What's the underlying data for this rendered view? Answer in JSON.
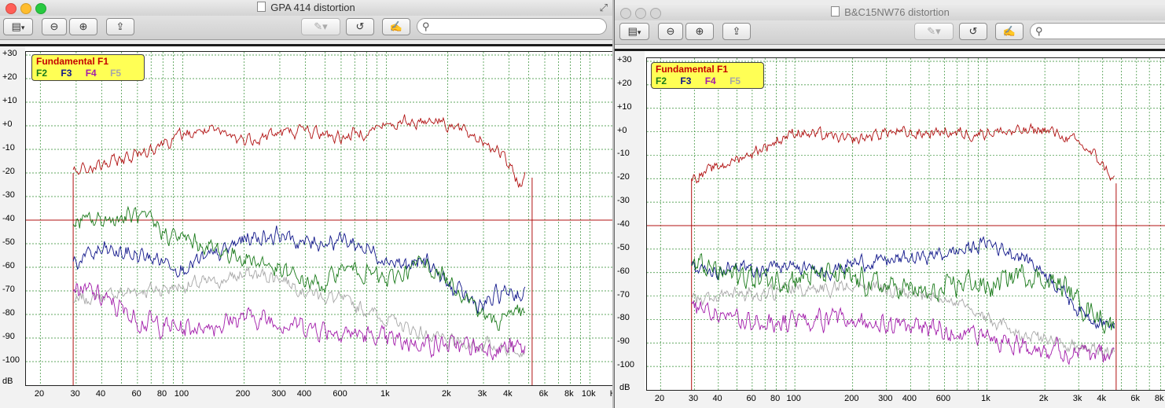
{
  "windows": [
    {
      "title": "GPA 414 distortion",
      "chart_data": {
        "type": "line",
        "xscale": "log",
        "xlim": [
          17,
          13000
        ],
        "ylim": [
          -110,
          30
        ],
        "yunit": "dB",
        "yticks": [
          "+30",
          "+20",
          "+10",
          "+0",
          "-10",
          "-20",
          "-30",
          "-40",
          "-50",
          "-60",
          "-70",
          "-80",
          "-90",
          "-100"
        ],
        "xticks": [
          {
            "v": 20,
            "t": "20"
          },
          {
            "v": 30,
            "t": "30"
          },
          {
            "v": 40,
            "t": "40"
          },
          {
            "v": 60,
            "t": "60"
          },
          {
            "v": 80,
            "t": "80"
          },
          {
            "v": 100,
            "t": "100"
          },
          {
            "v": 200,
            "t": "200"
          },
          {
            "v": 300,
            "t": "300"
          },
          {
            "v": 400,
            "t": "400"
          },
          {
            "v": 600,
            "t": "600"
          },
          {
            "v": 1000,
            "t": "1k"
          },
          {
            "v": 2000,
            "t": "2k"
          },
          {
            "v": 3000,
            "t": "3k"
          },
          {
            "v": 4000,
            "t": "4k"
          },
          {
            "v": 6000,
            "t": "6k"
          },
          {
            "v": 8000,
            "t": "8k"
          },
          {
            "v": 10000,
            "t": "10k"
          },
          {
            "v": 13000,
            "t": "H"
          }
        ],
        "range_start_hz": 29,
        "range_end_hz": 5200,
        "reference_level": -40,
        "legend_title": "Fundamental F1",
        "legend_items": [
          "F2",
          "F3",
          "F4",
          "F5"
        ],
        "series": [
          {
            "name": "Fundamental F1",
            "color": "#b01010",
            "noise": 2.2,
            "points": [
              [
                29,
                -20
              ],
              [
                40,
                -17
              ],
              [
                60,
                -12
              ],
              [
                80,
                -7
              ],
              [
                100,
                -4
              ],
              [
                130,
                -2
              ],
              [
                200,
                -6
              ],
              [
                300,
                -3
              ],
              [
                400,
                -2
              ],
              [
                600,
                -5
              ],
              [
                800,
                -2
              ],
              [
                1000,
                0
              ],
              [
                1400,
                2
              ],
              [
                1800,
                3
              ],
              [
                2200,
                -1
              ],
              [
                3000,
                -6
              ],
              [
                3600,
                -11
              ],
              [
                4000,
                -17
              ],
              [
                4500,
                -25
              ],
              [
                4800,
                -22
              ]
            ]
          },
          {
            "name": "F2",
            "color": "#1a7a1a",
            "noise": 3,
            "points": [
              [
                29,
                -41
              ],
              [
                40,
                -40
              ],
              [
                60,
                -38
              ],
              [
                80,
                -45
              ],
              [
                100,
                -48
              ],
              [
                150,
                -53
              ],
              [
                200,
                -56
              ],
              [
                250,
                -58
              ],
              [
                300,
                -62
              ],
              [
                400,
                -66
              ],
              [
                500,
                -68
              ],
              [
                600,
                -60
              ],
              [
                800,
                -62
              ],
              [
                1000,
                -66
              ],
              [
                1500,
                -58
              ],
              [
                2000,
                -65
              ],
              [
                2500,
                -72
              ],
              [
                3000,
                -80
              ],
              [
                3500,
                -84
              ],
              [
                4000,
                -78
              ],
              [
                4800,
                -80
              ]
            ]
          },
          {
            "name": "F3",
            "color": "#10168a",
            "noise": 3,
            "points": [
              [
                29,
                -58
              ],
              [
                40,
                -53
              ],
              [
                60,
                -55
              ],
              [
                80,
                -57
              ],
              [
                100,
                -60
              ],
              [
                150,
                -55
              ],
              [
                200,
                -48
              ],
              [
                300,
                -46
              ],
              [
                400,
                -50
              ],
              [
                600,
                -48
              ],
              [
                800,
                -52
              ],
              [
                1000,
                -56
              ],
              [
                1300,
                -60
              ],
              [
                1600,
                -57
              ],
              [
                2000,
                -68
              ],
              [
                2500,
                -73
              ],
              [
                3000,
                -77
              ],
              [
                3500,
                -72
              ],
              [
                4000,
                -70
              ],
              [
                4800,
                -72
              ]
            ]
          },
          {
            "name": "F4",
            "color": "#a21caa",
            "noise": 3.5,
            "points": [
              [
                29,
                -68
              ],
              [
                40,
                -73
              ],
              [
                60,
                -82
              ],
              [
                80,
                -85
              ],
              [
                100,
                -86
              ],
              [
                150,
                -84
              ],
              [
                200,
                -81
              ],
              [
                300,
                -83
              ],
              [
                400,
                -85
              ],
              [
                600,
                -87
              ],
              [
                800,
                -89
              ],
              [
                1000,
                -91
              ],
              [
                1500,
                -92
              ],
              [
                2000,
                -93
              ],
              [
                3000,
                -94
              ],
              [
                4000,
                -94
              ],
              [
                4800,
                -95
              ]
            ]
          },
          {
            "name": "F5",
            "color": "#a7a7a7",
            "noise": 2.5,
            "points": [
              [
                29,
                -75
              ],
              [
                40,
                -72
              ],
              [
                60,
                -70
              ],
              [
                80,
                -69
              ],
              [
                100,
                -68
              ],
              [
                150,
                -66
              ],
              [
                200,
                -63
              ],
              [
                300,
                -64
              ],
              [
                400,
                -70
              ],
              [
                600,
                -74
              ],
              [
                800,
                -78
              ],
              [
                1000,
                -82
              ],
              [
                1300,
                -86
              ],
              [
                1600,
                -89
              ],
              [
                2000,
                -92
              ],
              [
                3000,
                -93
              ],
              [
                4000,
                -94
              ],
              [
                4800,
                -94
              ]
            ]
          }
        ]
      }
    },
    {
      "title": "B&C15NW76 distortion",
      "chart_data": {
        "type": "line",
        "xscale": "log",
        "xlim": [
          17,
          8600
        ],
        "ylim": [
          -110,
          30
        ],
        "yunit": "dB",
        "yticks": [
          "+30",
          "+20",
          "+10",
          "+0",
          "-10",
          "-20",
          "-30",
          "-40",
          "-50",
          "-60",
          "-70",
          "-80",
          "-90",
          "-100"
        ],
        "xticks": [
          {
            "v": 20,
            "t": "20"
          },
          {
            "v": 30,
            "t": "30"
          },
          {
            "v": 40,
            "t": "40"
          },
          {
            "v": 60,
            "t": "60"
          },
          {
            "v": 80,
            "t": "80"
          },
          {
            "v": 100,
            "t": "100"
          },
          {
            "v": 200,
            "t": "200"
          },
          {
            "v": 300,
            "t": "300"
          },
          {
            "v": 400,
            "t": "400"
          },
          {
            "v": 600,
            "t": "600"
          },
          {
            "v": 1000,
            "t": "1k"
          },
          {
            "v": 2000,
            "t": "2k"
          },
          {
            "v": 3000,
            "t": "3k"
          },
          {
            "v": 4000,
            "t": "4k"
          },
          {
            "v": 6000,
            "t": "6k"
          },
          {
            "v": 8000,
            "t": "8k"
          }
        ],
        "range_start_hz": 29,
        "range_end_hz": 4700,
        "reference_level": -40,
        "legend_title": "Fundamental F1",
        "legend_items": [
          "F2",
          "F3",
          "F4",
          "F5"
        ],
        "series": [
          {
            "name": "Fundamental F1",
            "color": "#b01010",
            "noise": 2,
            "points": [
              [
                29,
                -20
              ],
              [
                40,
                -15
              ],
              [
                60,
                -9
              ],
              [
                80,
                -4
              ],
              [
                100,
                0
              ],
              [
                150,
                -2
              ],
              [
                200,
                -4
              ],
              [
                300,
                0
              ],
              [
                400,
                -1
              ],
              [
                600,
                0
              ],
              [
                800,
                -1
              ],
              [
                1000,
                0
              ],
              [
                1500,
                0
              ],
              [
                2000,
                1
              ],
              [
                2500,
                -2
              ],
              [
                3000,
                -5
              ],
              [
                3500,
                -9
              ],
              [
                4000,
                -14
              ],
              [
                4600,
                -21
              ]
            ]
          },
          {
            "name": "F2",
            "color": "#1a7a1a",
            "noise": 4,
            "points": [
              [
                29,
                -56
              ],
              [
                40,
                -60
              ],
              [
                60,
                -62
              ],
              [
                80,
                -63
              ],
              [
                100,
                -62
              ],
              [
                150,
                -61
              ],
              [
                200,
                -63
              ],
              [
                300,
                -66
              ],
              [
                400,
                -67
              ],
              [
                500,
                -70
              ],
              [
                600,
                -68
              ],
              [
                800,
                -63
              ],
              [
                1000,
                -67
              ],
              [
                1500,
                -60
              ],
              [
                2000,
                -63
              ],
              [
                2500,
                -66
              ],
              [
                3000,
                -72
              ],
              [
                3500,
                -76
              ],
              [
                4000,
                -80
              ],
              [
                4600,
                -82
              ]
            ]
          },
          {
            "name": "F3",
            "color": "#10168a",
            "noise": 2.5,
            "points": [
              [
                29,
                -57
              ],
              [
                40,
                -59
              ],
              [
                60,
                -58
              ],
              [
                80,
                -57
              ],
              [
                100,
                -58
              ],
              [
                150,
                -59
              ],
              [
                200,
                -56
              ],
              [
                300,
                -55
              ],
              [
                400,
                -54
              ],
              [
                600,
                -52
              ],
              [
                800,
                -50
              ],
              [
                1000,
                -47
              ],
              [
                1300,
                -51
              ],
              [
                1600,
                -54
              ],
              [
                2000,
                -60
              ],
              [
                2500,
                -68
              ],
              [
                3000,
                -76
              ],
              [
                3500,
                -79
              ],
              [
                4000,
                -81
              ],
              [
                4600,
                -83
              ]
            ]
          },
          {
            "name": "F4",
            "color": "#a21caa",
            "noise": 3.5,
            "points": [
              [
                29,
                -74
              ],
              [
                40,
                -78
              ],
              [
                60,
                -82
              ],
              [
                80,
                -82
              ],
              [
                100,
                -81
              ],
              [
                150,
                -80
              ],
              [
                200,
                -82
              ],
              [
                300,
                -83
              ],
              [
                400,
                -83
              ],
              [
                600,
                -84
              ],
              [
                800,
                -86
              ],
              [
                1000,
                -88
              ],
              [
                1500,
                -90
              ],
              [
                2000,
                -92
              ],
              [
                3000,
                -94
              ],
              [
                4000,
                -95
              ],
              [
                4600,
                -96
              ]
            ]
          },
          {
            "name": "F5",
            "color": "#a7a7a7",
            "noise": 2.5,
            "points": [
              [
                29,
                -72
              ],
              [
                40,
                -70
              ],
              [
                60,
                -69
              ],
              [
                80,
                -68
              ],
              [
                100,
                -67
              ],
              [
                150,
                -66
              ],
              [
                200,
                -65
              ],
              [
                300,
                -67
              ],
              [
                400,
                -70
              ],
              [
                600,
                -72
              ],
              [
                800,
                -74
              ],
              [
                1000,
                -80
              ],
              [
                1300,
                -84
              ],
              [
                1600,
                -87
              ],
              [
                2000,
                -89
              ],
              [
                3000,
                -91
              ],
              [
                4000,
                -93
              ],
              [
                4600,
                -94
              ]
            ]
          }
        ]
      }
    }
  ]
}
